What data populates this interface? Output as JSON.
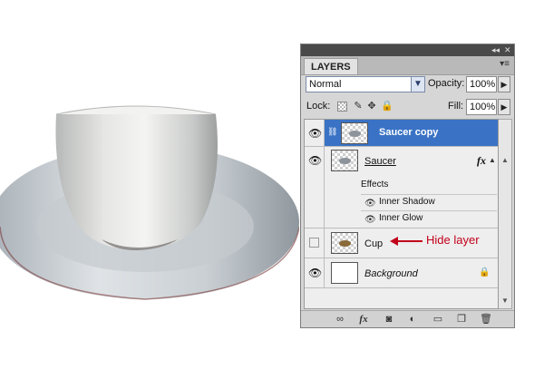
{
  "panel": {
    "tab_label": "LAYERS",
    "titlebar_collapse": "◂◂",
    "titlebar_close": "✕",
    "menu_icon": "▾≡",
    "blend_mode": "Normal",
    "opacity_label": "Opacity:",
    "opacity_value": "100%",
    "lock_label": "Lock:",
    "fill_label": "Fill:",
    "fill_value": "100%"
  },
  "layers": [
    {
      "name": "Saucer copy",
      "visible": true,
      "selected": true
    },
    {
      "name": "Saucer",
      "visible": true,
      "selected": false,
      "fx": "fx",
      "effects_label": "Effects",
      "effects": [
        "Inner Shadow",
        "Inner Glow"
      ]
    },
    {
      "name": "Cup",
      "visible": false,
      "selected": false
    },
    {
      "name": "Background",
      "visible": true,
      "selected": false
    }
  ],
  "footer_icons": [
    "link-icon",
    "fx-icon",
    "mask-icon",
    "adjustment-icon",
    "group-icon",
    "new-layer-icon",
    "trash-icon"
  ],
  "annotation": {
    "label": "Hide layer",
    "color": "#c2001a"
  },
  "colors": {
    "selection": "#3a73c5",
    "panel_bg": "#d6d6d6"
  }
}
